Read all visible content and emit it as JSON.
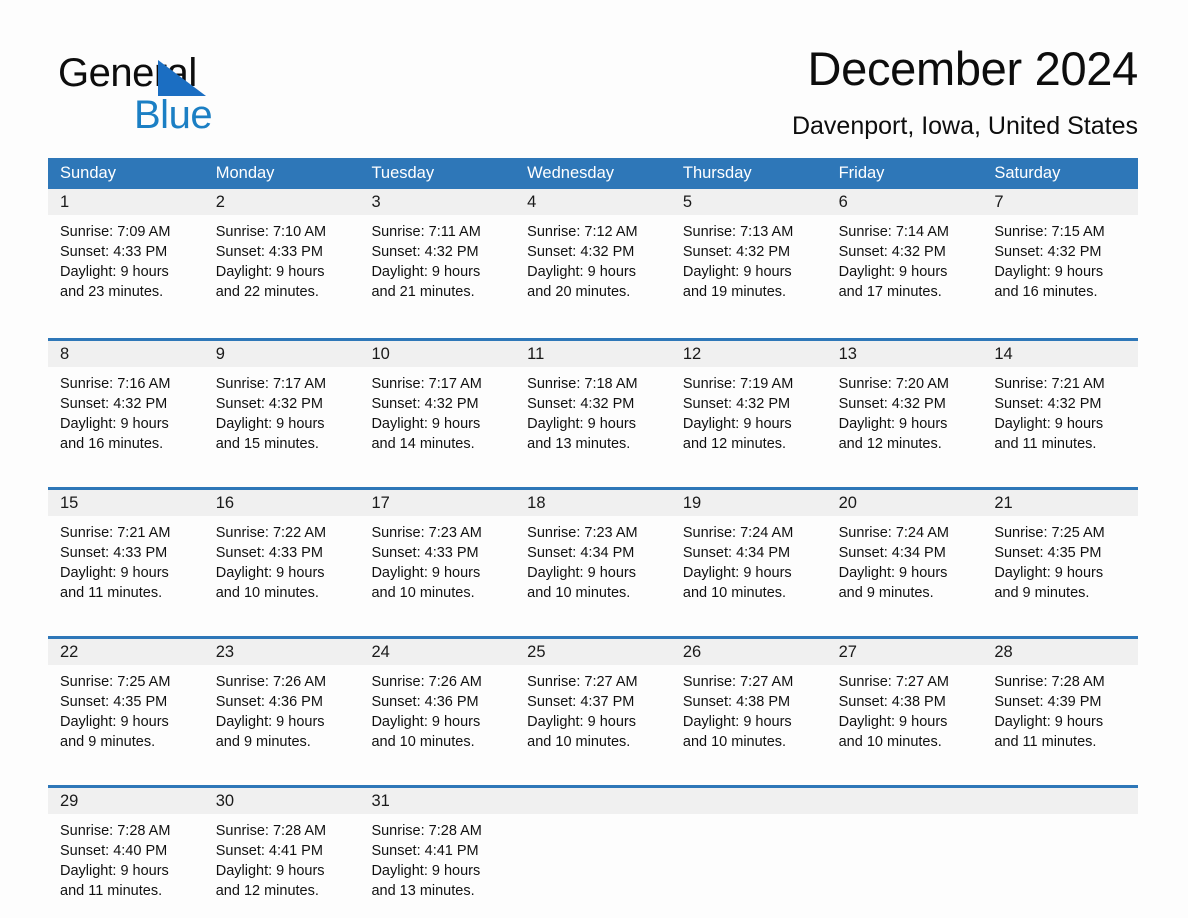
{
  "brand": {
    "word_one": "General",
    "word_two": "Blue",
    "triangle_color": "#1b6ec2",
    "blue_color": "#1b7fc4"
  },
  "header": {
    "month_title": "December 2024",
    "location": "Davenport, Iowa, United States"
  },
  "theme": {
    "header_blue": "#2e77b8",
    "row_divider_blue": "#2e77b8",
    "day_band_gray": "#f0f0f0",
    "page_background": "#fdfdfd",
    "text_color": "#111111"
  },
  "calendar": {
    "weekdays": [
      "Sunday",
      "Monday",
      "Tuesday",
      "Wednesday",
      "Thursday",
      "Friday",
      "Saturday"
    ],
    "weeks": [
      [
        {
          "day": "1",
          "lines": [
            "Sunrise: 7:09 AM",
            "Sunset: 4:33 PM",
            "Daylight: 9 hours",
            "and 23 minutes."
          ]
        },
        {
          "day": "2",
          "lines": [
            "Sunrise: 7:10 AM",
            "Sunset: 4:33 PM",
            "Daylight: 9 hours",
            "and 22 minutes."
          ]
        },
        {
          "day": "3",
          "lines": [
            "Sunrise: 7:11 AM",
            "Sunset: 4:32 PM",
            "Daylight: 9 hours",
            "and 21 minutes."
          ]
        },
        {
          "day": "4",
          "lines": [
            "Sunrise: 7:12 AM",
            "Sunset: 4:32 PM",
            "Daylight: 9 hours",
            "and 20 minutes."
          ]
        },
        {
          "day": "5",
          "lines": [
            "Sunrise: 7:13 AM",
            "Sunset: 4:32 PM",
            "Daylight: 9 hours",
            "and 19 minutes."
          ]
        },
        {
          "day": "6",
          "lines": [
            "Sunrise: 7:14 AM",
            "Sunset: 4:32 PM",
            "Daylight: 9 hours",
            "and 17 minutes."
          ]
        },
        {
          "day": "7",
          "lines": [
            "Sunrise: 7:15 AM",
            "Sunset: 4:32 PM",
            "Daylight: 9 hours",
            "and 16 minutes."
          ]
        }
      ],
      [
        {
          "day": "8",
          "lines": [
            "Sunrise: 7:16 AM",
            "Sunset: 4:32 PM",
            "Daylight: 9 hours",
            "and 16 minutes."
          ]
        },
        {
          "day": "9",
          "lines": [
            "Sunrise: 7:17 AM",
            "Sunset: 4:32 PM",
            "Daylight: 9 hours",
            "and 15 minutes."
          ]
        },
        {
          "day": "10",
          "lines": [
            "Sunrise: 7:17 AM",
            "Sunset: 4:32 PM",
            "Daylight: 9 hours",
            "and 14 minutes."
          ]
        },
        {
          "day": "11",
          "lines": [
            "Sunrise: 7:18 AM",
            "Sunset: 4:32 PM",
            "Daylight: 9 hours",
            "and 13 minutes."
          ]
        },
        {
          "day": "12",
          "lines": [
            "Sunrise: 7:19 AM",
            "Sunset: 4:32 PM",
            "Daylight: 9 hours",
            "and 12 minutes."
          ]
        },
        {
          "day": "13",
          "lines": [
            "Sunrise: 7:20 AM",
            "Sunset: 4:32 PM",
            "Daylight: 9 hours",
            "and 12 minutes."
          ]
        },
        {
          "day": "14",
          "lines": [
            "Sunrise: 7:21 AM",
            "Sunset: 4:32 PM",
            "Daylight: 9 hours",
            "and 11 minutes."
          ]
        }
      ],
      [
        {
          "day": "15",
          "lines": [
            "Sunrise: 7:21 AM",
            "Sunset: 4:33 PM",
            "Daylight: 9 hours",
            "and 11 minutes."
          ]
        },
        {
          "day": "16",
          "lines": [
            "Sunrise: 7:22 AM",
            "Sunset: 4:33 PM",
            "Daylight: 9 hours",
            "and 10 minutes."
          ]
        },
        {
          "day": "17",
          "lines": [
            "Sunrise: 7:23 AM",
            "Sunset: 4:33 PM",
            "Daylight: 9 hours",
            "and 10 minutes."
          ]
        },
        {
          "day": "18",
          "lines": [
            "Sunrise: 7:23 AM",
            "Sunset: 4:34 PM",
            "Daylight: 9 hours",
            "and 10 minutes."
          ]
        },
        {
          "day": "19",
          "lines": [
            "Sunrise: 7:24 AM",
            "Sunset: 4:34 PM",
            "Daylight: 9 hours",
            "and 10 minutes."
          ]
        },
        {
          "day": "20",
          "lines": [
            "Sunrise: 7:24 AM",
            "Sunset: 4:34 PM",
            "Daylight: 9 hours",
            "and 9 minutes."
          ]
        },
        {
          "day": "21",
          "lines": [
            "Sunrise: 7:25 AM",
            "Sunset: 4:35 PM",
            "Daylight: 9 hours",
            "and 9 minutes."
          ]
        }
      ],
      [
        {
          "day": "22",
          "lines": [
            "Sunrise: 7:25 AM",
            "Sunset: 4:35 PM",
            "Daylight: 9 hours",
            "and 9 minutes."
          ]
        },
        {
          "day": "23",
          "lines": [
            "Sunrise: 7:26 AM",
            "Sunset: 4:36 PM",
            "Daylight: 9 hours",
            "and 9 minutes."
          ]
        },
        {
          "day": "24",
          "lines": [
            "Sunrise: 7:26 AM",
            "Sunset: 4:36 PM",
            "Daylight: 9 hours",
            "and 10 minutes."
          ]
        },
        {
          "day": "25",
          "lines": [
            "Sunrise: 7:27 AM",
            "Sunset: 4:37 PM",
            "Daylight: 9 hours",
            "and 10 minutes."
          ]
        },
        {
          "day": "26",
          "lines": [
            "Sunrise: 7:27 AM",
            "Sunset: 4:38 PM",
            "Daylight: 9 hours",
            "and 10 minutes."
          ]
        },
        {
          "day": "27",
          "lines": [
            "Sunrise: 7:27 AM",
            "Sunset: 4:38 PM",
            "Daylight: 9 hours",
            "and 10 minutes."
          ]
        },
        {
          "day": "28",
          "lines": [
            "Sunrise: 7:28 AM",
            "Sunset: 4:39 PM",
            "Daylight: 9 hours",
            "and 11 minutes."
          ]
        }
      ],
      [
        {
          "day": "29",
          "lines": [
            "Sunrise: 7:28 AM",
            "Sunset: 4:40 PM",
            "Daylight: 9 hours",
            "and 11 minutes."
          ]
        },
        {
          "day": "30",
          "lines": [
            "Sunrise: 7:28 AM",
            "Sunset: 4:41 PM",
            "Daylight: 9 hours",
            "and 12 minutes."
          ]
        },
        {
          "day": "31",
          "lines": [
            "Sunrise: 7:28 AM",
            "Sunset: 4:41 PM",
            "Daylight: 9 hours",
            "and 13 minutes."
          ]
        },
        {
          "day": "",
          "lines": []
        },
        {
          "day": "",
          "lines": []
        },
        {
          "day": "",
          "lines": []
        },
        {
          "day": "",
          "lines": []
        }
      ]
    ]
  }
}
